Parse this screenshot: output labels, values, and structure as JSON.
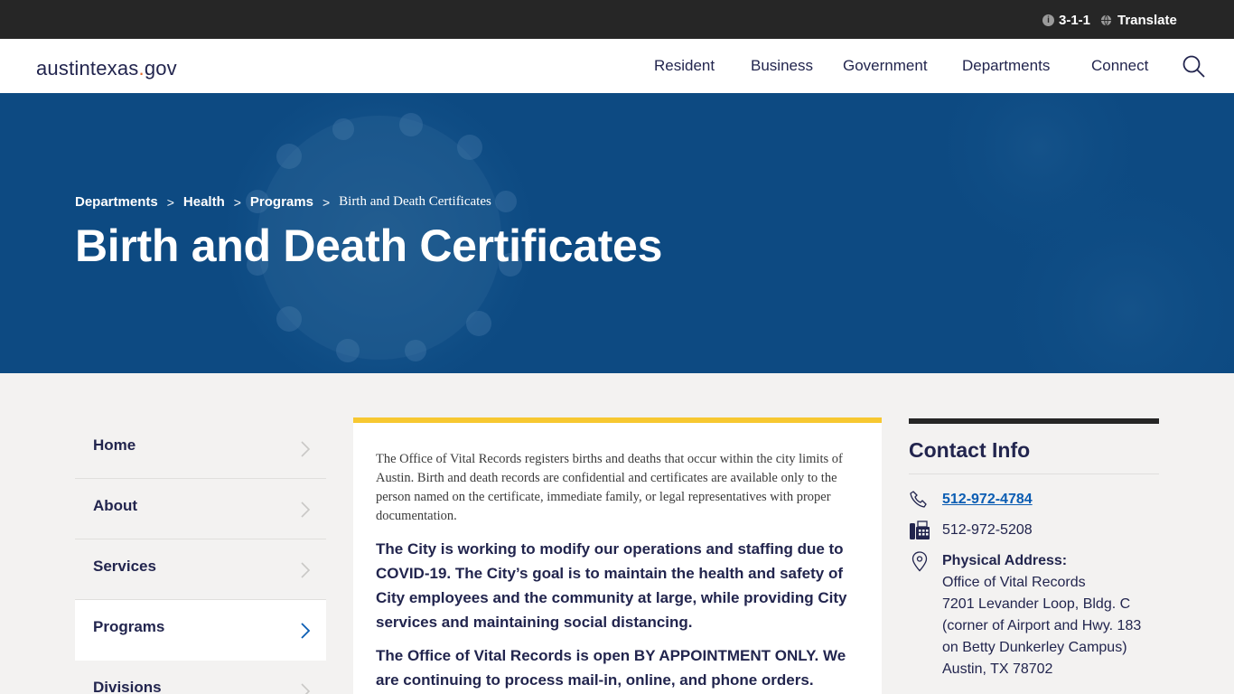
{
  "utility": {
    "phone_311": "3-1-1",
    "translate": "Translate"
  },
  "header": {
    "logo_main": "austintexas",
    "logo_dot": ".",
    "logo_tld": "gov",
    "nav": [
      "Resident",
      "Business",
      "Government",
      "Departments",
      "Connect"
    ]
  },
  "hero": {
    "breadcrumb": [
      "Departments",
      "Health",
      "Programs"
    ],
    "breadcrumb_separator": ">",
    "breadcrumb_current": "Birth and Death Certificates",
    "title": "Birth and Death Certificates"
  },
  "sidenav": {
    "items": [
      "Home",
      "About",
      "Services",
      "Programs",
      "Divisions"
    ],
    "active": "Programs"
  },
  "main": {
    "intro": "The Office of Vital Records registers births and deaths that occur within the city limits of Austin. Birth and death records are confidential and certificates are available only to the person named on the certificate, immediate family, or legal representatives with proper documentation.",
    "covid_notice": "The City is working to modify our operations and staffing due to COVID-19. The City’s goal is to maintain the health and safety of City employees and the community at large, while providing City services and maintaining social distancing.",
    "appointment_notice": "The Office of Vital Records is open BY APPOINTMENT ONLY. We are continuing to process mail-in, online, and phone orders."
  },
  "contact": {
    "title": "Contact Info",
    "phone": "512-972-4784",
    "fax": "512-972-5208",
    "address_label": "Physical Address:",
    "address_lines": [
      "Office of Vital Records",
      "7201 Levander Loop, Bldg. C",
      "(corner of Airport and Hwy. 183",
      "on Betty Dunkerley Campus)",
      "Austin, TX 78702"
    ]
  },
  "colors": {
    "utility_bg": "#262626",
    "hero_bg": "#0e4f88",
    "accent_yellow": "#f7c831",
    "link_blue": "#0b5db3",
    "text_navy": "#22254e",
    "page_bg": "#f3f2f1"
  },
  "icons": [
    "info-icon",
    "globe-icon",
    "search-icon",
    "chevron-right-icon",
    "phone-icon",
    "fax-icon",
    "map-pin-icon"
  ]
}
